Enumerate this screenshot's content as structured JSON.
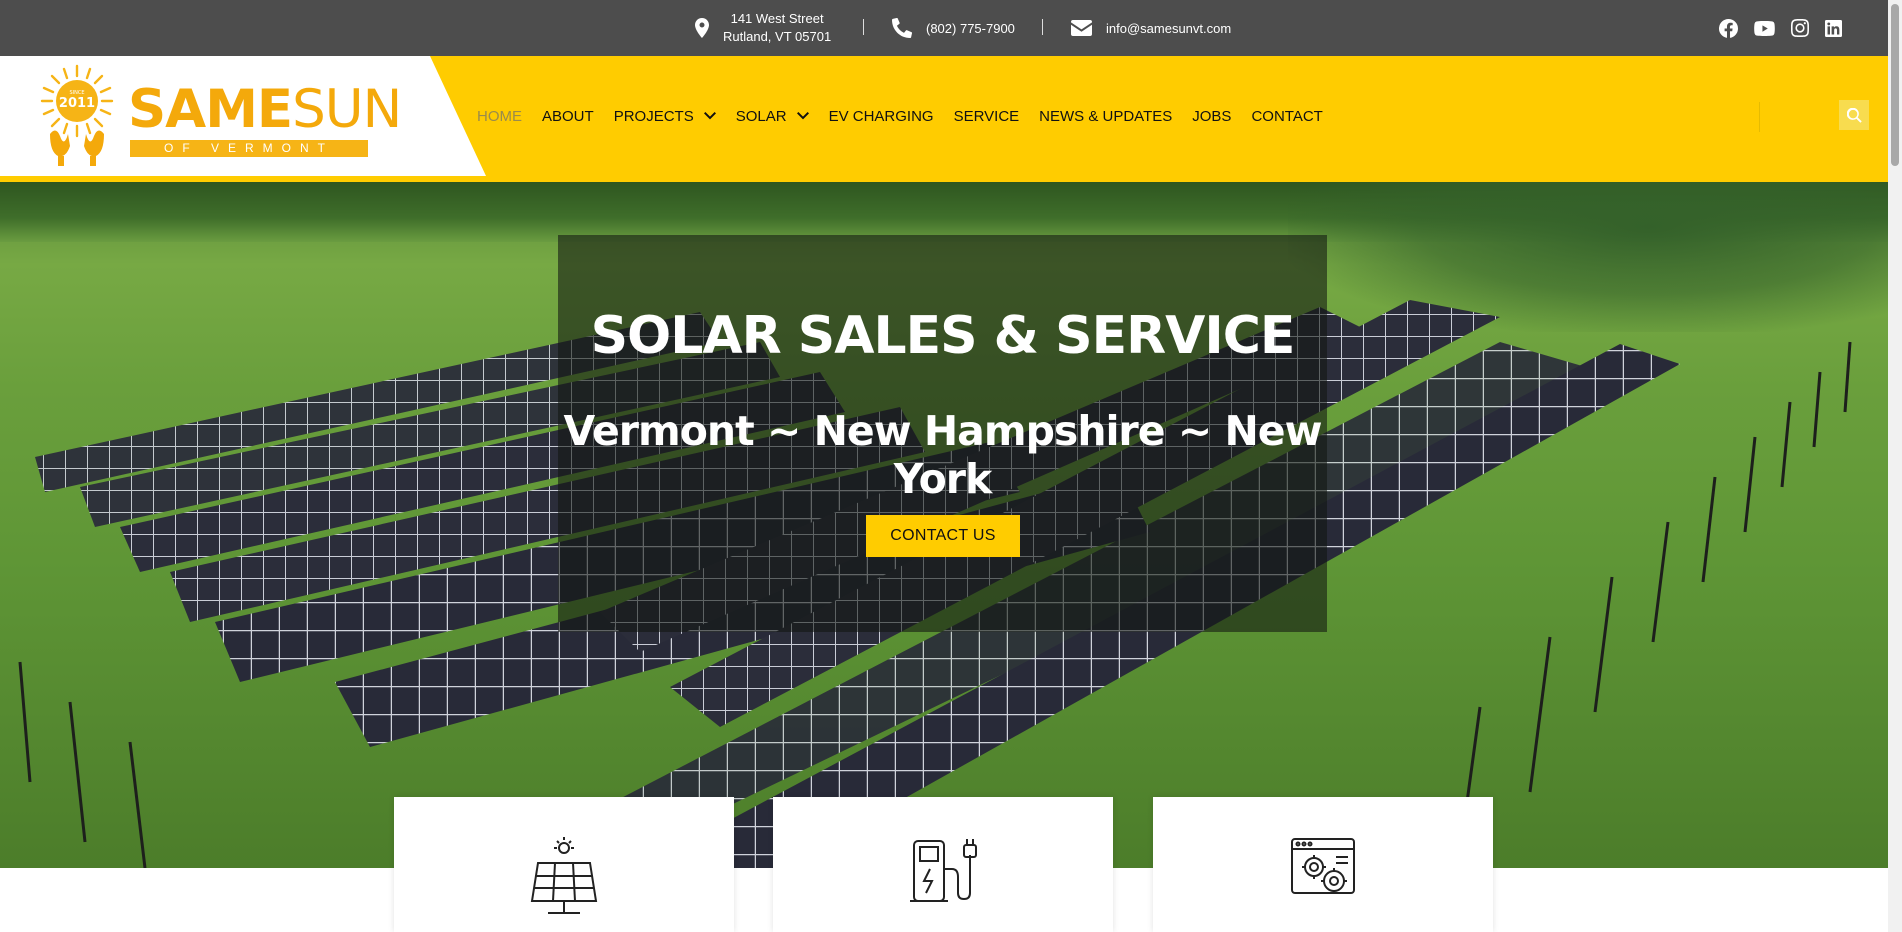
{
  "topbar": {
    "address_line1": "141 West Street",
    "address_line2": "Rutland, VT 05701",
    "phone": "(802) 775-7900",
    "email": "info@samesunvt.com",
    "social": [
      "facebook-icon",
      "youtube-icon",
      "instagram-icon",
      "linkedin-icon"
    ]
  },
  "logo": {
    "badge_top": "SINCE",
    "badge_year": "2011",
    "name_bold": "SAME",
    "name_light": "SUN",
    "tagline": "OF VERMONT"
  },
  "nav": {
    "items": [
      {
        "label": "HOME",
        "active": true
      },
      {
        "label": "ABOUT"
      },
      {
        "label": "PROJECTS",
        "dropdown": true
      },
      {
        "label": "SOLAR",
        "dropdown": true
      },
      {
        "label": "EV CHARGING"
      },
      {
        "label": "SERVICE"
      },
      {
        "label": "NEWS & UPDATES"
      },
      {
        "label": "JOBS"
      },
      {
        "label": "CONTACT"
      }
    ]
  },
  "hero": {
    "title": "SOLAR SALES & SERVICE",
    "subtitle": "Vermont ~ New Hampshire ~ New York",
    "cta": "CONTACT US"
  },
  "cards": [
    "solar-panel-icon",
    "ev-charger-icon",
    "service-gear-icon"
  ],
  "colors": {
    "brand_yellow": "#ffcc00",
    "topbar_bg": "#4d4d4d",
    "logo_orange": "#f4a90b"
  }
}
